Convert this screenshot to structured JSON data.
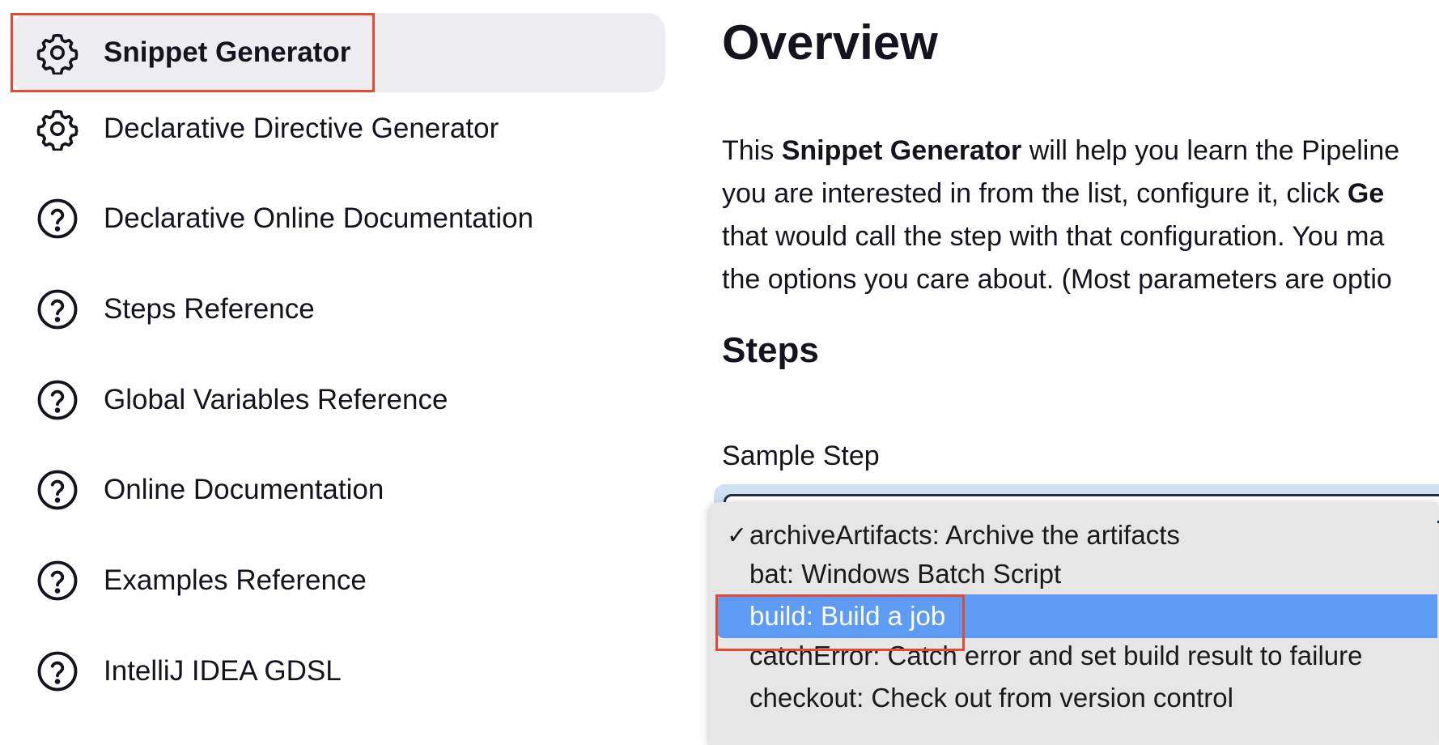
{
  "sidebar": {
    "items": [
      {
        "label": "Snippet Generator",
        "icon": "gear-icon",
        "active": true
      },
      {
        "label": "Declarative Directive Generator",
        "icon": "gear-icon"
      },
      {
        "label": "Declarative Online Documentation",
        "icon": "help-circle-icon"
      },
      {
        "label": "Steps Reference",
        "icon": "help-circle-icon"
      },
      {
        "label": "Global Variables Reference",
        "icon": "help-circle-icon"
      },
      {
        "label": "Online Documentation",
        "icon": "help-circle-icon"
      },
      {
        "label": "Examples Reference",
        "icon": "help-circle-icon"
      },
      {
        "label": "IntelliJ IDEA GDSL",
        "icon": "help-circle-icon"
      }
    ]
  },
  "main": {
    "title": "Overview",
    "overview_lines": [
      {
        "pre": "This ",
        "bold": "Snippet Generator",
        "post": " will help you learn the Pipeline"
      },
      {
        "pre": "you are interested in from the list, configure it, click ",
        "bold": "Ge",
        "post": ""
      },
      {
        "pre": "that would call the step with that configuration. You ma",
        "bold": "",
        "post": ""
      },
      {
        "pre": "the options you care about. (Most parameters are optio",
        "bold": "",
        "post": ""
      }
    ],
    "steps_title": "Steps",
    "sample_step_label": "Sample Step",
    "dropdown": {
      "options": [
        {
          "label": "archiveArtifacts: Archive the artifacts",
          "checked": true
        },
        {
          "label": "bat: Windows Batch Script"
        },
        {
          "label": "build: Build a job",
          "highlighted": true
        },
        {
          "label": "catchError: Catch error and set build result to failure"
        },
        {
          "label": "checkout: Check out from version control"
        }
      ],
      "check_mark": "✓"
    }
  },
  "colors": {
    "active_bg": "#ececf1",
    "highlight_outline": "#e34a33",
    "selected_option_bg": "#5e9bf5",
    "dropdown_bg": "#e6e6e6"
  }
}
